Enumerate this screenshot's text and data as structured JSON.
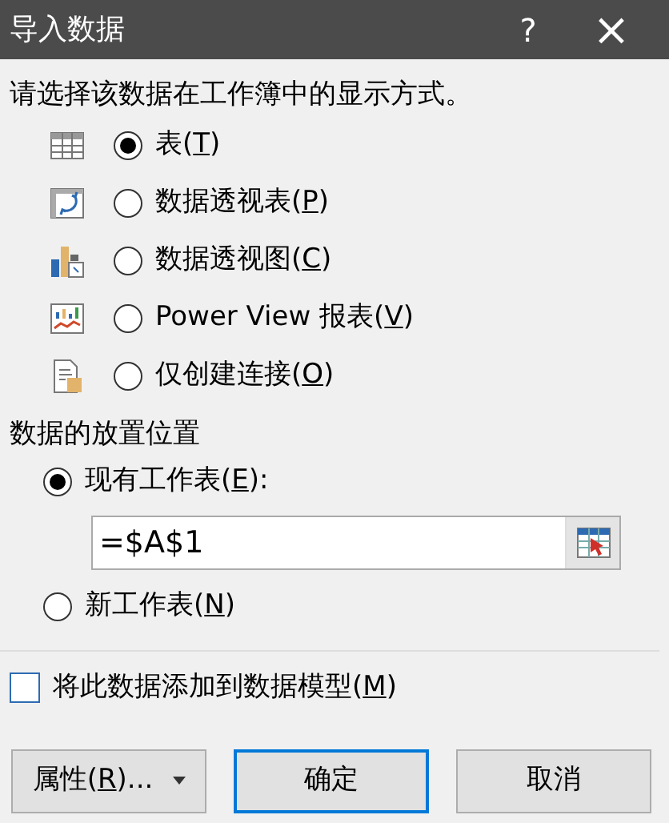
{
  "window": {
    "title": "导入数据",
    "help": "?",
    "close": "×"
  },
  "display": {
    "prompt": "请选择该数据在工作簿中的显示方式。",
    "options": [
      {
        "kind": "table",
        "label": [
          "表(",
          "T",
          ")"
        ],
        "selected": true
      },
      {
        "kind": "pivot-table",
        "label": [
          "数据透视表(",
          "P",
          ")"
        ],
        "selected": false
      },
      {
        "kind": "pivot-chart",
        "label": [
          "数据透视图(",
          "C",
          ")"
        ],
        "selected": false
      },
      {
        "kind": "power-view",
        "label": [
          "Power View 报表(",
          "V",
          ")"
        ],
        "selected": false
      },
      {
        "kind": "connection",
        "label": [
          "仅创建连接(",
          "O",
          ")"
        ],
        "selected": false
      }
    ]
  },
  "placement": {
    "heading": "数据的放置位置",
    "existing": {
      "label": [
        "现有工作表(",
        "E",
        "):"
      ],
      "selected": true,
      "value": "=$A$1"
    },
    "new": {
      "label": [
        "新工作表(",
        "N",
        ")"
      ],
      "selected": false
    }
  },
  "data_model": {
    "label": [
      "将此数据添加到数据模型(",
      "M",
      ")"
    ],
    "checked": false
  },
  "buttons": [
    {
      "kind": "dropdown",
      "label": [
        "属性(",
        "R",
        ")..."
      ],
      "default": false
    },
    {
      "kind": "plain",
      "label": [
        "确定"
      ],
      "default": true
    },
    {
      "kind": "plain",
      "label": [
        "取消"
      ],
      "default": false
    }
  ]
}
